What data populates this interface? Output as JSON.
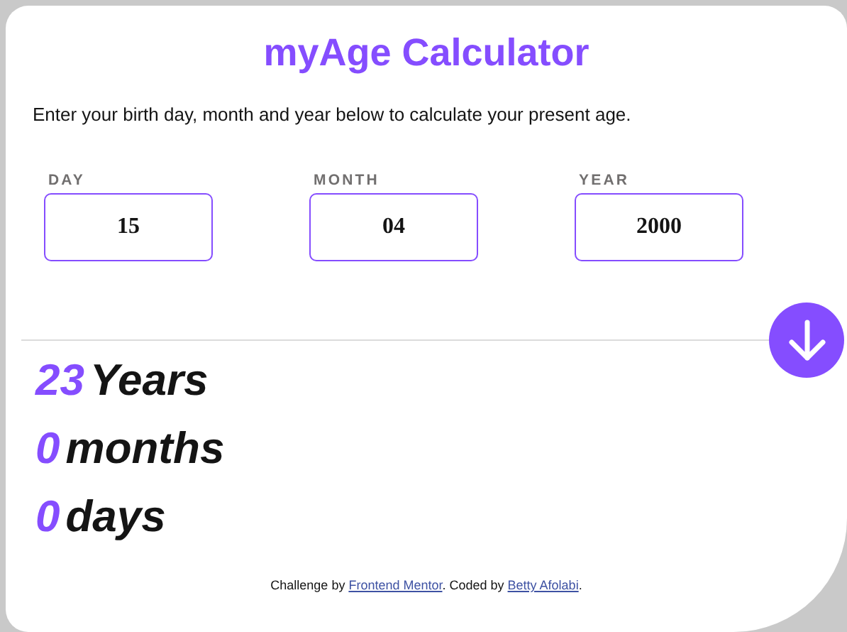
{
  "title": "myAge Calculator",
  "description": "Enter your birth day, month and year below to calculate your present age.",
  "fields": [
    {
      "label": "DAY",
      "value": "15"
    },
    {
      "label": "MONTH",
      "value": "04"
    },
    {
      "label": "YEAR",
      "value": "2000"
    }
  ],
  "results": [
    {
      "number": "23",
      "unit": "Years"
    },
    {
      "number": "0",
      "unit": "months"
    },
    {
      "number": "0",
      "unit": "days"
    }
  ],
  "footer": [
    {
      "kind": "text",
      "text": "Challenge by "
    },
    {
      "kind": "link",
      "text": "Frontend Mentor"
    },
    {
      "kind": "text",
      "text": ". Coded by "
    },
    {
      "kind": "link",
      "text": "Betty Afolabi"
    },
    {
      "kind": "text",
      "text": "."
    }
  ]
}
